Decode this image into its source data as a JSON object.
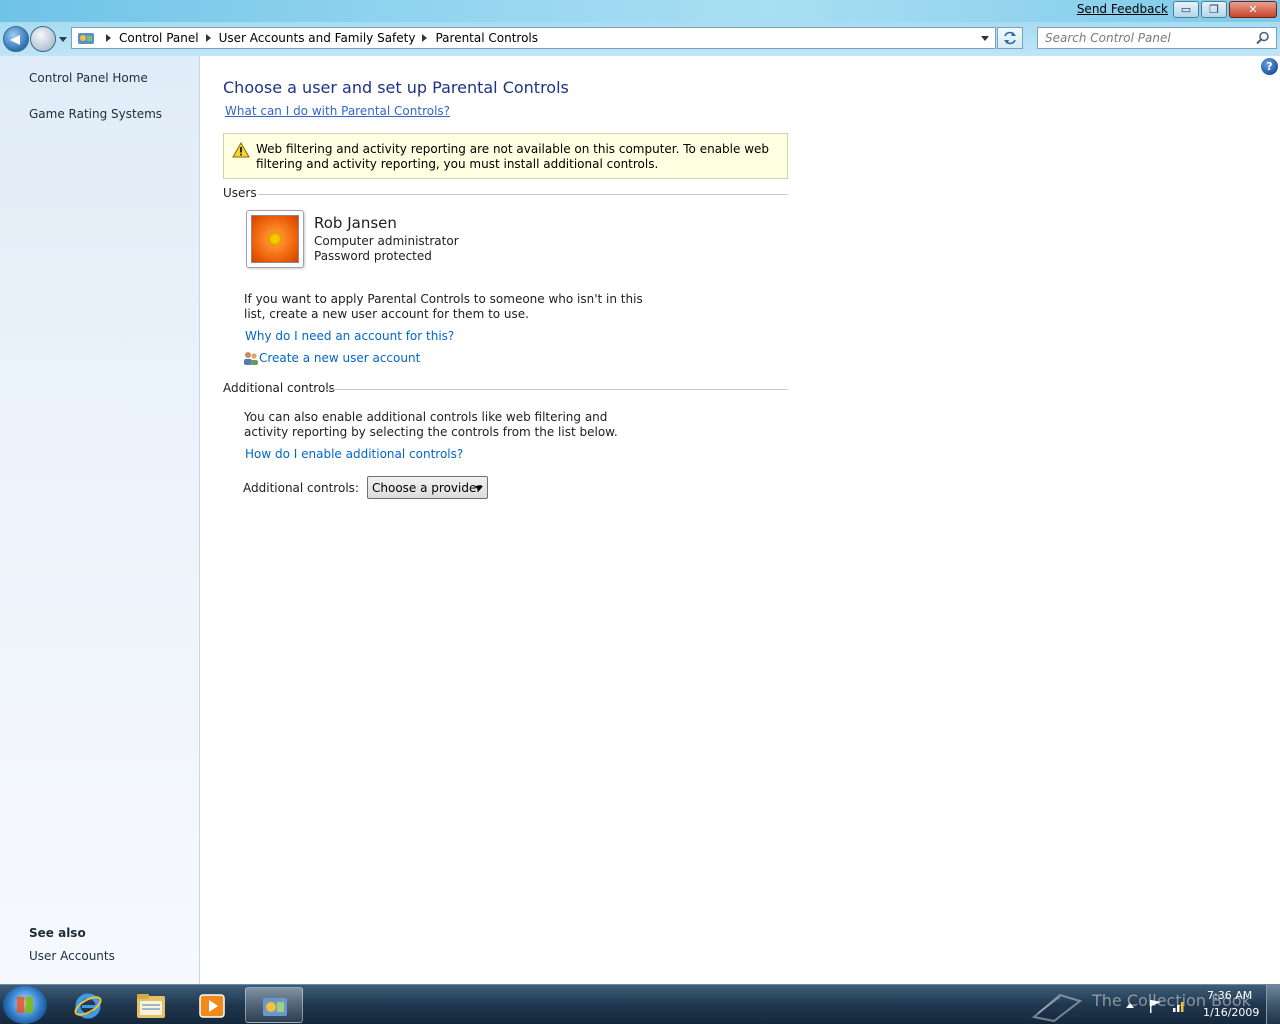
{
  "titlebar": {
    "feedback_label": "Send Feedback",
    "min_label": "▭",
    "max_label": "❐",
    "close_label": "✕"
  },
  "address": {
    "crumbs": [
      "Control Panel",
      "User Accounts and Family Safety",
      "Parental Controls"
    ]
  },
  "search": {
    "placeholder": "Search Control Panel"
  },
  "sidebar": {
    "links": [
      "Control Panel Home",
      "Game Rating Systems"
    ],
    "see_also_title": "See also",
    "see_also_links": [
      "User Accounts"
    ]
  },
  "main": {
    "help_label": "?",
    "title": "Choose a user and set up Parental Controls",
    "what_link": "What can I do with Parental Controls?",
    "warning": "Web filtering and activity reporting are not available on this computer. To enable web filtering and activity reporting, you must install additional controls.",
    "users_section": "Users",
    "user": {
      "name": "Rob Jansen",
      "role": "Computer administrator",
      "password": "Password protected"
    },
    "apply_text": "If you want to apply Parental Controls to someone who isn't in this list, create a new user account for them to use.",
    "why_link": "Why do I need an account for this?",
    "create_link": "Create a new user account",
    "additional_section": "Additional controls",
    "additional_text": "You can also enable additional controls like web filtering and activity reporting by selecting the controls from the list below.",
    "how_link": "How do I enable additional controls?",
    "controls_label": "Additional controls:",
    "provider_selected": "Choose a provider"
  },
  "taskbar": {
    "items": [
      "start-orb",
      "internet-explorer-icon",
      "windows-explorer-icon",
      "media-player-icon",
      "control-panel-icon"
    ],
    "watermark": "The Collection Book",
    "time": "7:36 AM",
    "date": "1/16/2009"
  },
  "colors": {
    "title_blue": "#1e3287",
    "link_blue": "#0066cc",
    "warning_bg": "#ffffe1",
    "taskbar": "#20384f"
  }
}
